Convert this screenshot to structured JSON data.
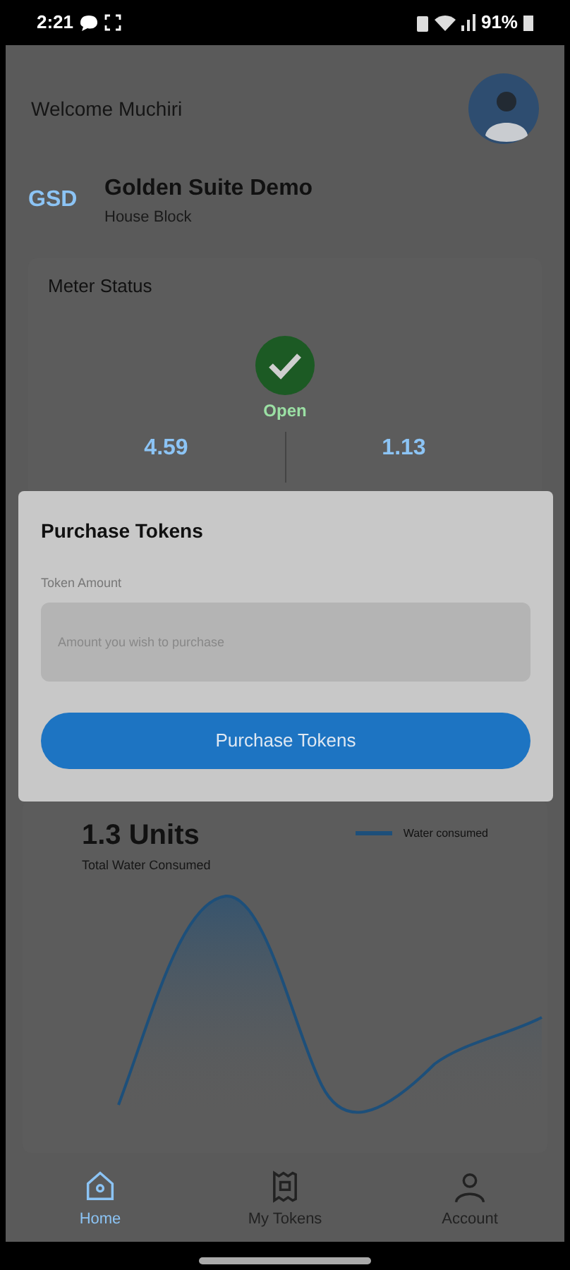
{
  "status_bar": {
    "time": "2:21",
    "battery": "91%"
  },
  "greeting": "Welcome Muchiri",
  "property": {
    "initials": "GSD",
    "name": "Golden Suite Demo",
    "subtitle": "House Block"
  },
  "meter": {
    "title": "Meter Status",
    "state": "Open",
    "stats": [
      {
        "value": "4.59"
      },
      {
        "value": "1.13"
      }
    ]
  },
  "dialog": {
    "title": "Purchase Tokens",
    "field_label": "Token Amount",
    "placeholder": "Amount you wish to purchase",
    "button": "Purchase Tokens"
  },
  "usage": {
    "total": "1.3 Units",
    "caption": "Total Water Consumed",
    "legend": "Water consumed"
  },
  "nav": [
    {
      "label": "Home",
      "selected": true
    },
    {
      "label": "My Tokens",
      "selected": false
    },
    {
      "label": "Account",
      "selected": false
    }
  ]
}
